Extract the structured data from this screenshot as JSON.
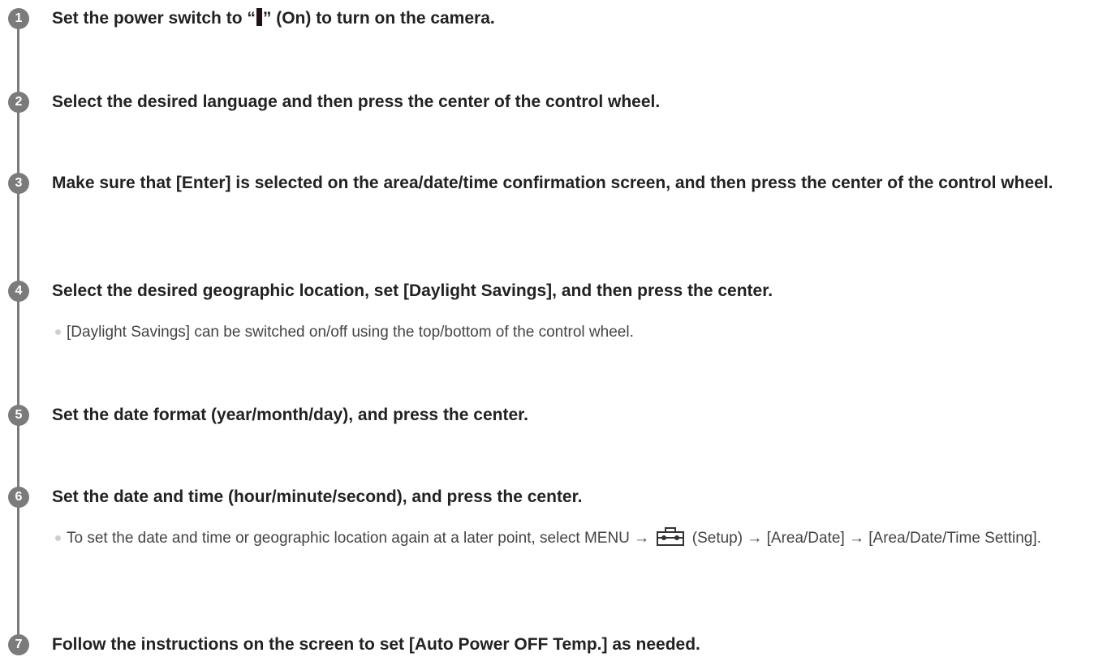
{
  "steps": [
    {
      "number": "1",
      "before": "Set the power switch to “",
      "after": "” (On) to turn on the camera."
    },
    {
      "number": "2",
      "text": "Select the desired language and then press the center of the control wheel."
    },
    {
      "number": "3",
      "text": "Make sure that [Enter] is selected on the area/date/time confirmation screen, and then press the center of the control wheel."
    },
    {
      "number": "4",
      "text": "Select the desired geographic location, set [Daylight Savings], and then press the center.",
      "note": "[Daylight Savings] can be switched on/off using the top/bottom of the control wheel."
    },
    {
      "number": "5",
      "text": "Set the date format (year/month/day), and press the center."
    },
    {
      "number": "6",
      "text": "Set the date and time (hour/minute/second), and press the center.",
      "note_before": "To set the date and time or geographic location again at a later point, select MENU →",
      "note_after": "(Setup) → [Area/Date] → [Area/Date/Time Setting]."
    },
    {
      "number": "7",
      "text": "Follow the instructions on the screen to set [Auto Power OFF Temp.] as needed."
    }
  ],
  "icons": {
    "step_badge": "circled-number",
    "power_on": "power-on-bar-icon",
    "setup": "toolbox-icon",
    "note_bullet": "bullet-dot"
  },
  "colors": {
    "text": "#222222",
    "note_text": "#444444",
    "timeline": "#7b7b7b",
    "bullet": "#cfcfcf"
  }
}
